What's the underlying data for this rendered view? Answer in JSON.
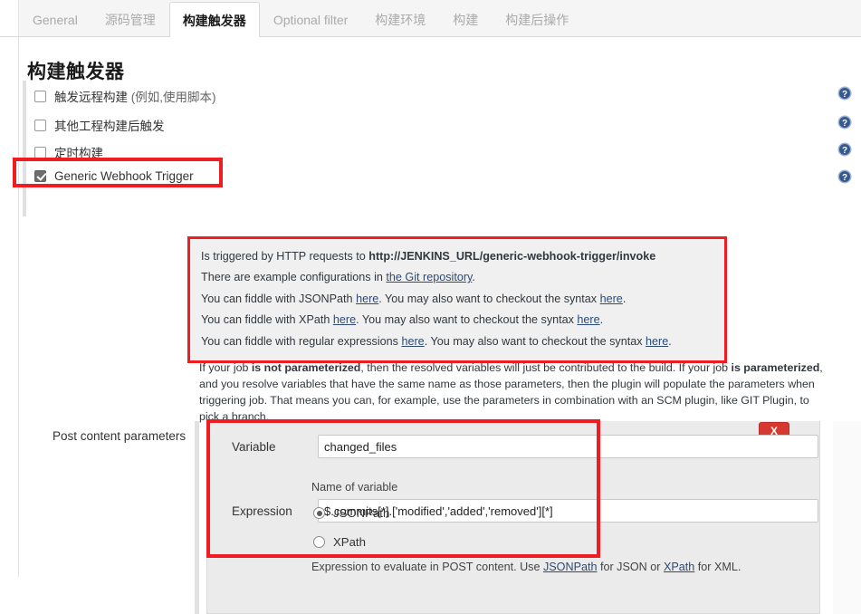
{
  "tabs": [
    {
      "label": "General",
      "active": false
    },
    {
      "label": "源码管理",
      "active": false
    },
    {
      "label": "构建触发器",
      "active": true
    },
    {
      "label": "Optional filter",
      "active": false
    },
    {
      "label": "构建环境",
      "active": false
    },
    {
      "label": "构建",
      "active": false
    },
    {
      "label": "构建后操作",
      "active": false
    }
  ],
  "section": {
    "title": "构建触发器"
  },
  "triggers": [
    {
      "label": "触发远程构建 ",
      "suffix": "(例如,使用脚本)",
      "checked": false
    },
    {
      "label": "其他工程构建后触发",
      "suffix": "",
      "checked": false
    },
    {
      "label": "定时构建",
      "suffix": "",
      "checked": false
    },
    {
      "label": "Generic Webhook Trigger",
      "suffix": "",
      "checked": true
    }
  ],
  "info": {
    "line1": {
      "pre": "Is triggered by HTTP requests to ",
      "bold": "http://JENKINS_URL/generic-webhook-trigger/invoke"
    },
    "line2": {
      "pre": "There are example configurations in ",
      "link": "the Git repository",
      "post": "."
    },
    "line3": {
      "pre": "You can fiddle with JSONPath ",
      "link1": "here",
      "mid": ". You may also want to checkout the syntax ",
      "link2": "here",
      "post": "."
    },
    "line4": {
      "pre": "You can fiddle with XPath ",
      "link1": "here",
      "mid": ". You may also want to checkout the syntax ",
      "link2": "here",
      "post": "."
    },
    "line5": {
      "pre": "You can fiddle with regular expressions ",
      "link1": "here",
      "mid": ". You may also want to checkout the syntax ",
      "link2": "here",
      "post": "."
    }
  },
  "paragraph": {
    "part1": "If your job ",
    "bold1": "is not parameterized",
    "part2": ", then the resolved variables will just be contributed to the build. If your job ",
    "bold2": "is parameterized",
    "part3": ", and you resolve variables that have the same name as those parameters, then the plugin will populate the parameters when triggering job. That means you can, for example, use the parameters in combination with an SCM plugin, like GIT Plugin, to pick a branch."
  },
  "post_content_parameters": {
    "label": "Post content parameters",
    "remove_button": "X",
    "variable": {
      "label": "Variable",
      "value": "changed_files",
      "hint": "Name of variable"
    },
    "expression": {
      "label": "Expression",
      "value": "$.commits[*].['modified','added','removed'][*]",
      "hint_pre": "Expression to evaluate in POST content. Use ",
      "hint_link1": "JSONPath",
      "hint_mid": " for JSON or ",
      "hint_link2": "XPath",
      "hint_post": " for XML."
    },
    "expression_type": {
      "selected": "JSONPath",
      "options": [
        {
          "label": "JSONPath",
          "selected": true
        },
        {
          "label": "XPath",
          "selected": false
        }
      ]
    }
  },
  "help_icons": [
    {
      "name": "help-icon-remote-build"
    },
    {
      "name": "help-icon-after-other-projects"
    },
    {
      "name": "help-icon-scheduled-build"
    },
    {
      "name": "help-icon-generic-webhook"
    }
  ],
  "colors": {
    "highlight": "#ef1c22",
    "link": "#2c4a75",
    "danger_button": "#d6392f",
    "panel_bg": "#ebebeb",
    "info_bg": "#f0f0f0"
  }
}
